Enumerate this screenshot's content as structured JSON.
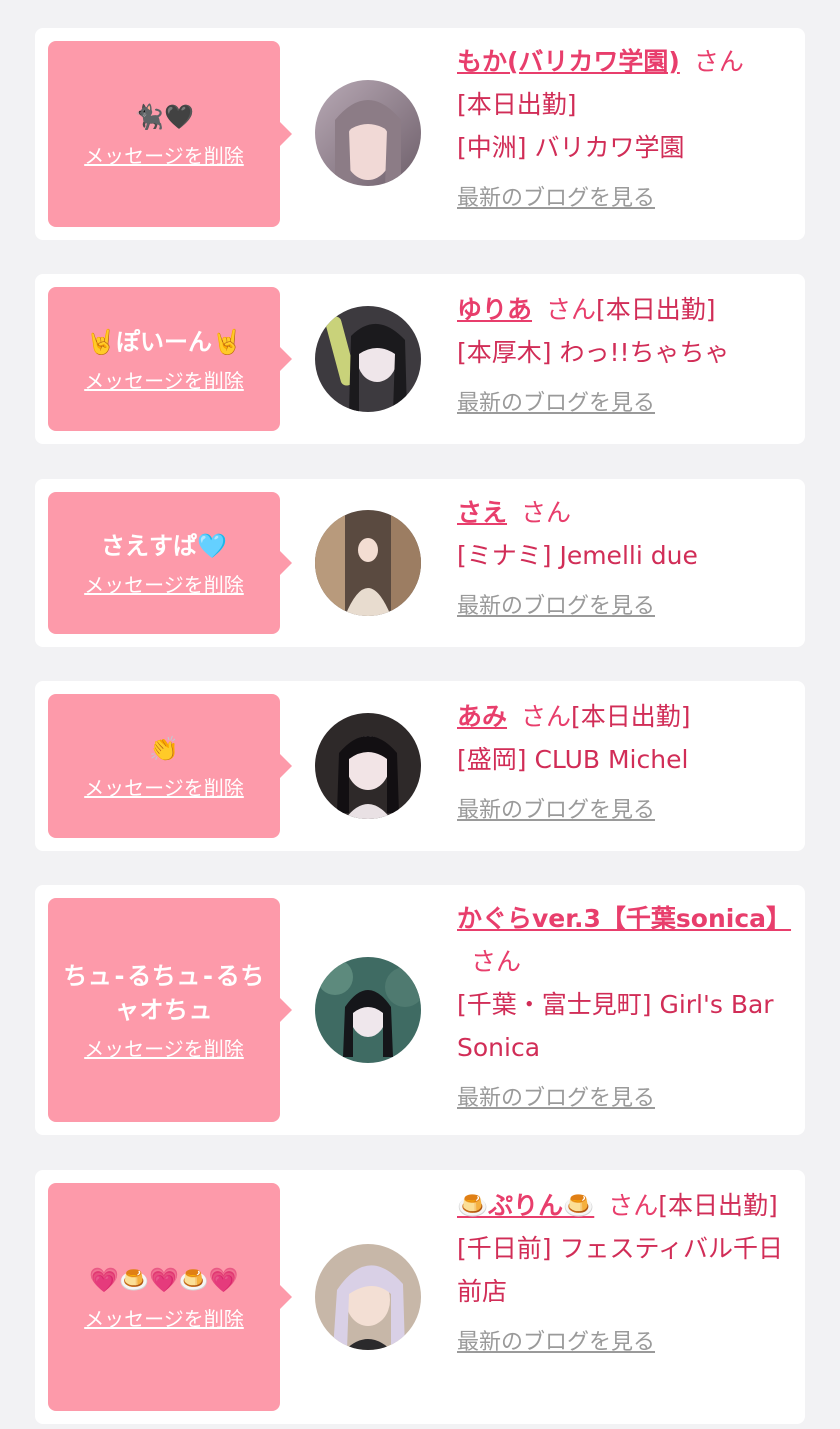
{
  "delete_label": "メッセージを削除",
  "honorific": "さん",
  "blog_label": "最新のブログを見る",
  "colors": {
    "bubble": "#fd9aaa",
    "name": "#e83e6c",
    "text": "#d12d57",
    "link_gray": "#9a9a9a",
    "background": "#f2f2f4"
  },
  "cards": [
    {
      "message": "🐈‍⬛🖤",
      "name": "もか(バリカワ学園)",
      "status": "[本日出勤]",
      "shop": "[中洲] バリカワ学園",
      "avatar_icon": "portrait-photo"
    },
    {
      "message": "🤘ぽいーん🤘",
      "name": "ゆりあ",
      "status": "[本日出勤]",
      "shop": "[本厚木] わっ!!ちゃちゃ",
      "avatar_icon": "portrait-photo"
    },
    {
      "message": "さえすぱ🩵",
      "name": "さえ",
      "status": "",
      "shop": "[ミナミ] Jemelli due",
      "avatar_icon": "portrait-photo"
    },
    {
      "message": "👏",
      "name": "あみ",
      "status": "[本日出勤]",
      "shop": "[盛岡] CLUB Michel",
      "avatar_icon": "portrait-photo"
    },
    {
      "message": "ちュ-るちュ-るちャオちュ",
      "name": "かぐらver.3【千葉sonica】",
      "status": "",
      "shop": "[千葉・富士見町] Girl's Bar Sonica",
      "avatar_icon": "portrait-photo"
    },
    {
      "message": "💗🍮💗🍮💗",
      "name": "🍮ぷりん🍮",
      "status": "[本日出勤]",
      "shop": "[千日前] フェスティバル千日前店",
      "avatar_icon": "portrait-photo"
    }
  ]
}
